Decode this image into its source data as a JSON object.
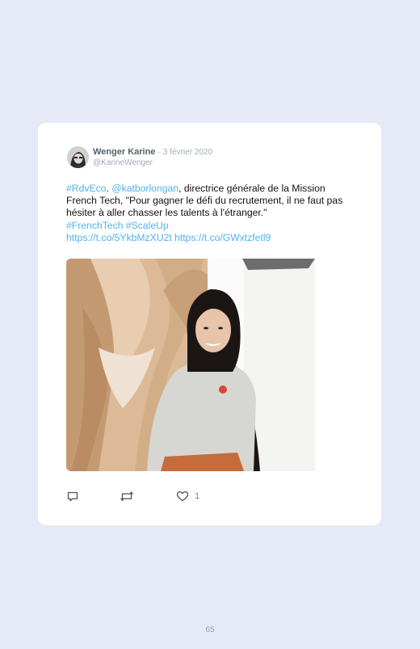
{
  "tweet": {
    "author_name": "Wenger Karine",
    "separator": "·",
    "date": "3 février 2020",
    "handle": "@KarineWenger",
    "text": {
      "hashtag_rdveco": "#RdvEco",
      "sep1": ". ",
      "mention": "@katborlongan",
      "body_1": ", directrice générale de la Mission French Tech, \"Pour gagner le défi du recrutement, il ne faut pas hésiter à aller chasser les talents à l'étranger.\"",
      "hashtag_frenchtech": "#FrenchTech",
      "hashtag_scaleup": "#ScaleUp",
      "link_1": "https://t.co/5YkbMzXU2t",
      "link_2": "https://t.co/GWxtzfetl9"
    },
    "actions": {
      "reply_icon": "comment-icon",
      "retweet_icon": "retweet-icon",
      "like_icon": "heart-icon",
      "like_count": "1"
    }
  },
  "page_number": "65",
  "colors": {
    "page_background": "#e6eaf6",
    "card_background": "#ffffff",
    "link": "#4fb3ea",
    "muted": "#a2abb6"
  }
}
